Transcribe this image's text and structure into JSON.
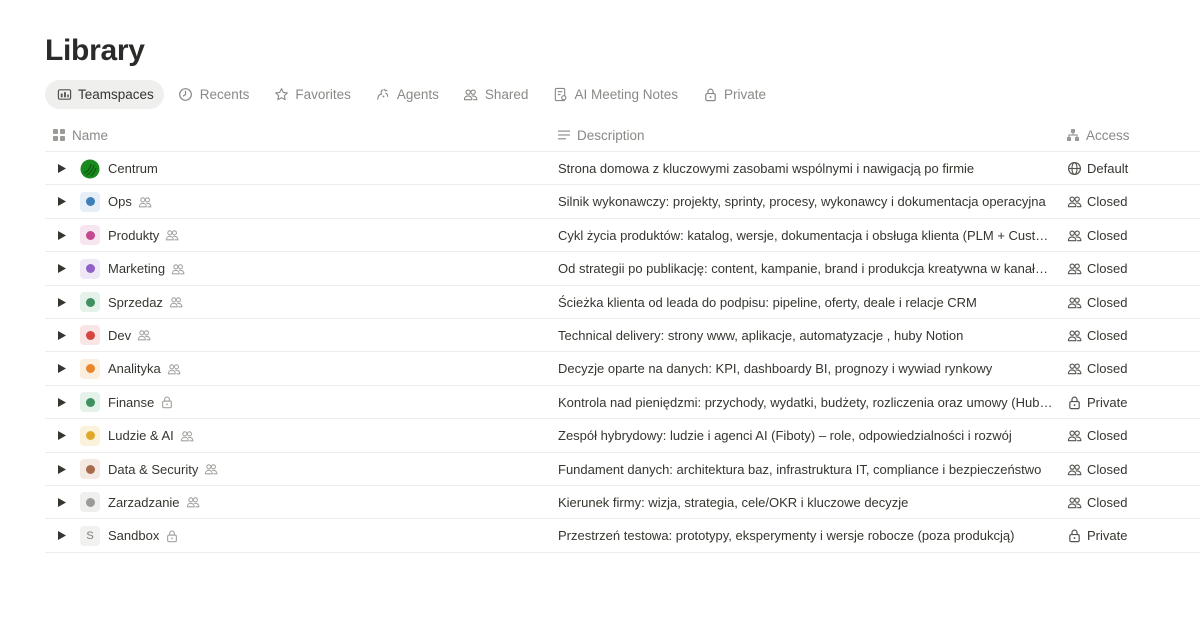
{
  "page": {
    "title": "Library"
  },
  "tabs": [
    {
      "label": "Teamspaces",
      "icon": "teamspace-icon",
      "active": true
    },
    {
      "label": "Recents",
      "icon": "clock-icon",
      "active": false
    },
    {
      "label": "Favorites",
      "icon": "star-icon",
      "active": false
    },
    {
      "label": "Agents",
      "icon": "agent-icon",
      "active": false
    },
    {
      "label": "Shared",
      "icon": "people-icon",
      "active": false
    },
    {
      "label": "AI Meeting Notes",
      "icon": "meeting-notes-icon",
      "active": false
    },
    {
      "label": "Private",
      "icon": "lock-icon",
      "active": false
    }
  ],
  "table": {
    "columns": {
      "name": "Name",
      "description": "Description",
      "access": "Access"
    },
    "rows": [
      {
        "name": "Centrum",
        "icon_color": "#1a8a1f",
        "icon_type": "logo",
        "member_icon": "",
        "description": "Strona domowa z kluczowymi zasobami wspólnymi i nawigacją po firmie",
        "access": "Default",
        "access_icon": "globe-icon"
      },
      {
        "name": "Ops",
        "icon_color": "#3f7fb8",
        "icon_bg": "#e6eff7",
        "member_icon": "people-icon",
        "description": "Silnik wykonawczy: projekty, sprinty, procesy, wykonawcy i dokumentacja operacyjna",
        "access": "Closed",
        "access_icon": "people-icon"
      },
      {
        "name": "Produkty",
        "icon_color": "#c6488f",
        "icon_bg": "#f7e6f0",
        "member_icon": "people-icon",
        "description": "Cykl życia produktów: katalog, wersje, dokumentacja i obsługa klienta (PLM + Customer Support)",
        "access": "Closed",
        "access_icon": "people-icon"
      },
      {
        "name": "Marketing",
        "icon_color": "#8f60c7",
        "icon_bg": "#efe8f7",
        "member_icon": "people-icon",
        "description": "Od strategii po publikację: content, kampanie, brand i produkcja kreatywna w kanałach",
        "access": "Closed",
        "access_icon": "people-icon"
      },
      {
        "name": "Sprzedaz",
        "icon_color": "#3f8f60",
        "icon_bg": "#e5f2ea",
        "member_icon": "people-icon",
        "description": "Ścieżka klienta od leada do podpisu: pipeline, oferty, deale i relacje CRM",
        "access": "Closed",
        "access_icon": "people-icon"
      },
      {
        "name": "Dev",
        "icon_color": "#d4463f",
        "icon_bg": "#f8e5e4",
        "member_icon": "people-icon",
        "description": "Technical delivery: strony www, aplikacje, automatyzacje , huby Notion",
        "access": "Closed",
        "access_icon": "people-icon"
      },
      {
        "name": "Analityka",
        "icon_color": "#e8862a",
        "icon_bg": "#fbeedf",
        "member_icon": "people-icon",
        "description": "Decyzje oparte na danych: KPI, dashboardy BI, prognozy i wywiad rynkowy",
        "access": "Closed",
        "access_icon": "people-icon"
      },
      {
        "name": "Finanse",
        "icon_color": "#3f8f60",
        "icon_bg": "#e5f2ea",
        "member_icon": "lock-icon",
        "description": "Kontrola nad pieniędzmi: przychody, wydatki, budżety, rozliczenia oraz umowy (Hub Prawny)",
        "access": "Private",
        "access_icon": "lock-icon"
      },
      {
        "name": "Ludzie & AI",
        "icon_color": "#e0a92a",
        "icon_bg": "#fbf2dc",
        "member_icon": "people-icon",
        "description": "Zespół hybrydowy: ludzie i agenci AI (Fiboty) – role, odpowiedzialności i rozwój",
        "access": "Closed",
        "access_icon": "people-icon"
      },
      {
        "name": "Data & Security",
        "icon_color": "#a86a4c",
        "icon_bg": "#f4e9e3",
        "member_icon": "people-icon",
        "description": "Fundament danych: architektura baz, infrastruktura IT, compliance i bezpieczeństwo",
        "access": "Closed",
        "access_icon": "people-icon"
      },
      {
        "name": "Zarzadzanie",
        "icon_color": "#9b9a97",
        "icon_bg": "#efefed",
        "member_icon": "people-icon",
        "description": "Kierunek firmy: wizja, strategia, cele/OKR i kluczowe decyzje",
        "access": "Closed",
        "access_icon": "people-icon"
      },
      {
        "name": "Sandbox",
        "icon_letter": "S",
        "icon_type": "letter",
        "member_icon": "lock-icon",
        "description": "Przestrzeń testowa: prototypy, eksperymenty i wersje robocze (poza produkcją)",
        "access": "Private",
        "access_icon": "lock-icon"
      }
    ]
  }
}
